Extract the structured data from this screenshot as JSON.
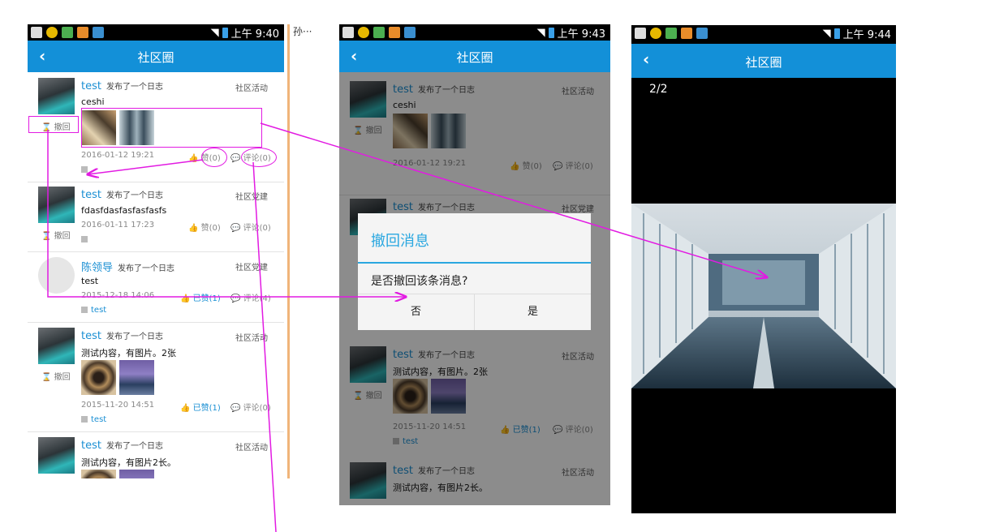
{
  "colors": {
    "accent": "#1390d8",
    "link": "#1a8fd3",
    "annotation": "#e21be2"
  },
  "side_note": "孙···",
  "screens": [
    {
      "time": "上午 9:40",
      "title": "社区圈"
    },
    {
      "time": "上午 9:43",
      "title": "社区圈"
    },
    {
      "time": "上午 9:44",
      "title": "社区圈"
    }
  ],
  "back_icon": "chevron-left-icon",
  "posts": [
    {
      "user": "test",
      "action": "发布了一个日志",
      "category": "社区活动",
      "content": "ceshi",
      "withdraw": "撤回",
      "time": "2016-01-12 19:21",
      "like": "赞(0)",
      "comment": "评论(0)",
      "tag": ""
    },
    {
      "user": "test",
      "action": "发布了一个日志",
      "category": "社区党建",
      "content": "fdasfdasfasfasfasfs",
      "withdraw": "撤回",
      "time": "2016-01-11 17:23",
      "like": "赞(0)",
      "comment": "评论(0)",
      "tag": ""
    },
    {
      "user": "陈领导",
      "action": "发布了一个日志",
      "category": "社区党建",
      "content": "test",
      "withdraw": "",
      "time": "2015-12-18 14:06",
      "like": "已赞(1)",
      "comment": "评论(4)",
      "tag": "test"
    },
    {
      "user": "test",
      "action": "发布了一个日志",
      "category": "社区活动",
      "content": "测试内容，有图片。2张",
      "withdraw": "撤回",
      "time": "2015-11-20 14:51",
      "like": "已赞(1)",
      "comment": "评论(0)",
      "tag": "test"
    },
    {
      "user": "test",
      "action": "发布了一个日志",
      "category": "社区活动",
      "content": "测试内容，有图片2长。",
      "withdraw": "",
      "time": "",
      "like": "",
      "comment": "",
      "tag": ""
    }
  ],
  "dialog": {
    "title": "撤回消息",
    "message": "是否撤回该条消息?",
    "no": "否",
    "yes": "是"
  },
  "viewer": {
    "counter": "2/2"
  }
}
